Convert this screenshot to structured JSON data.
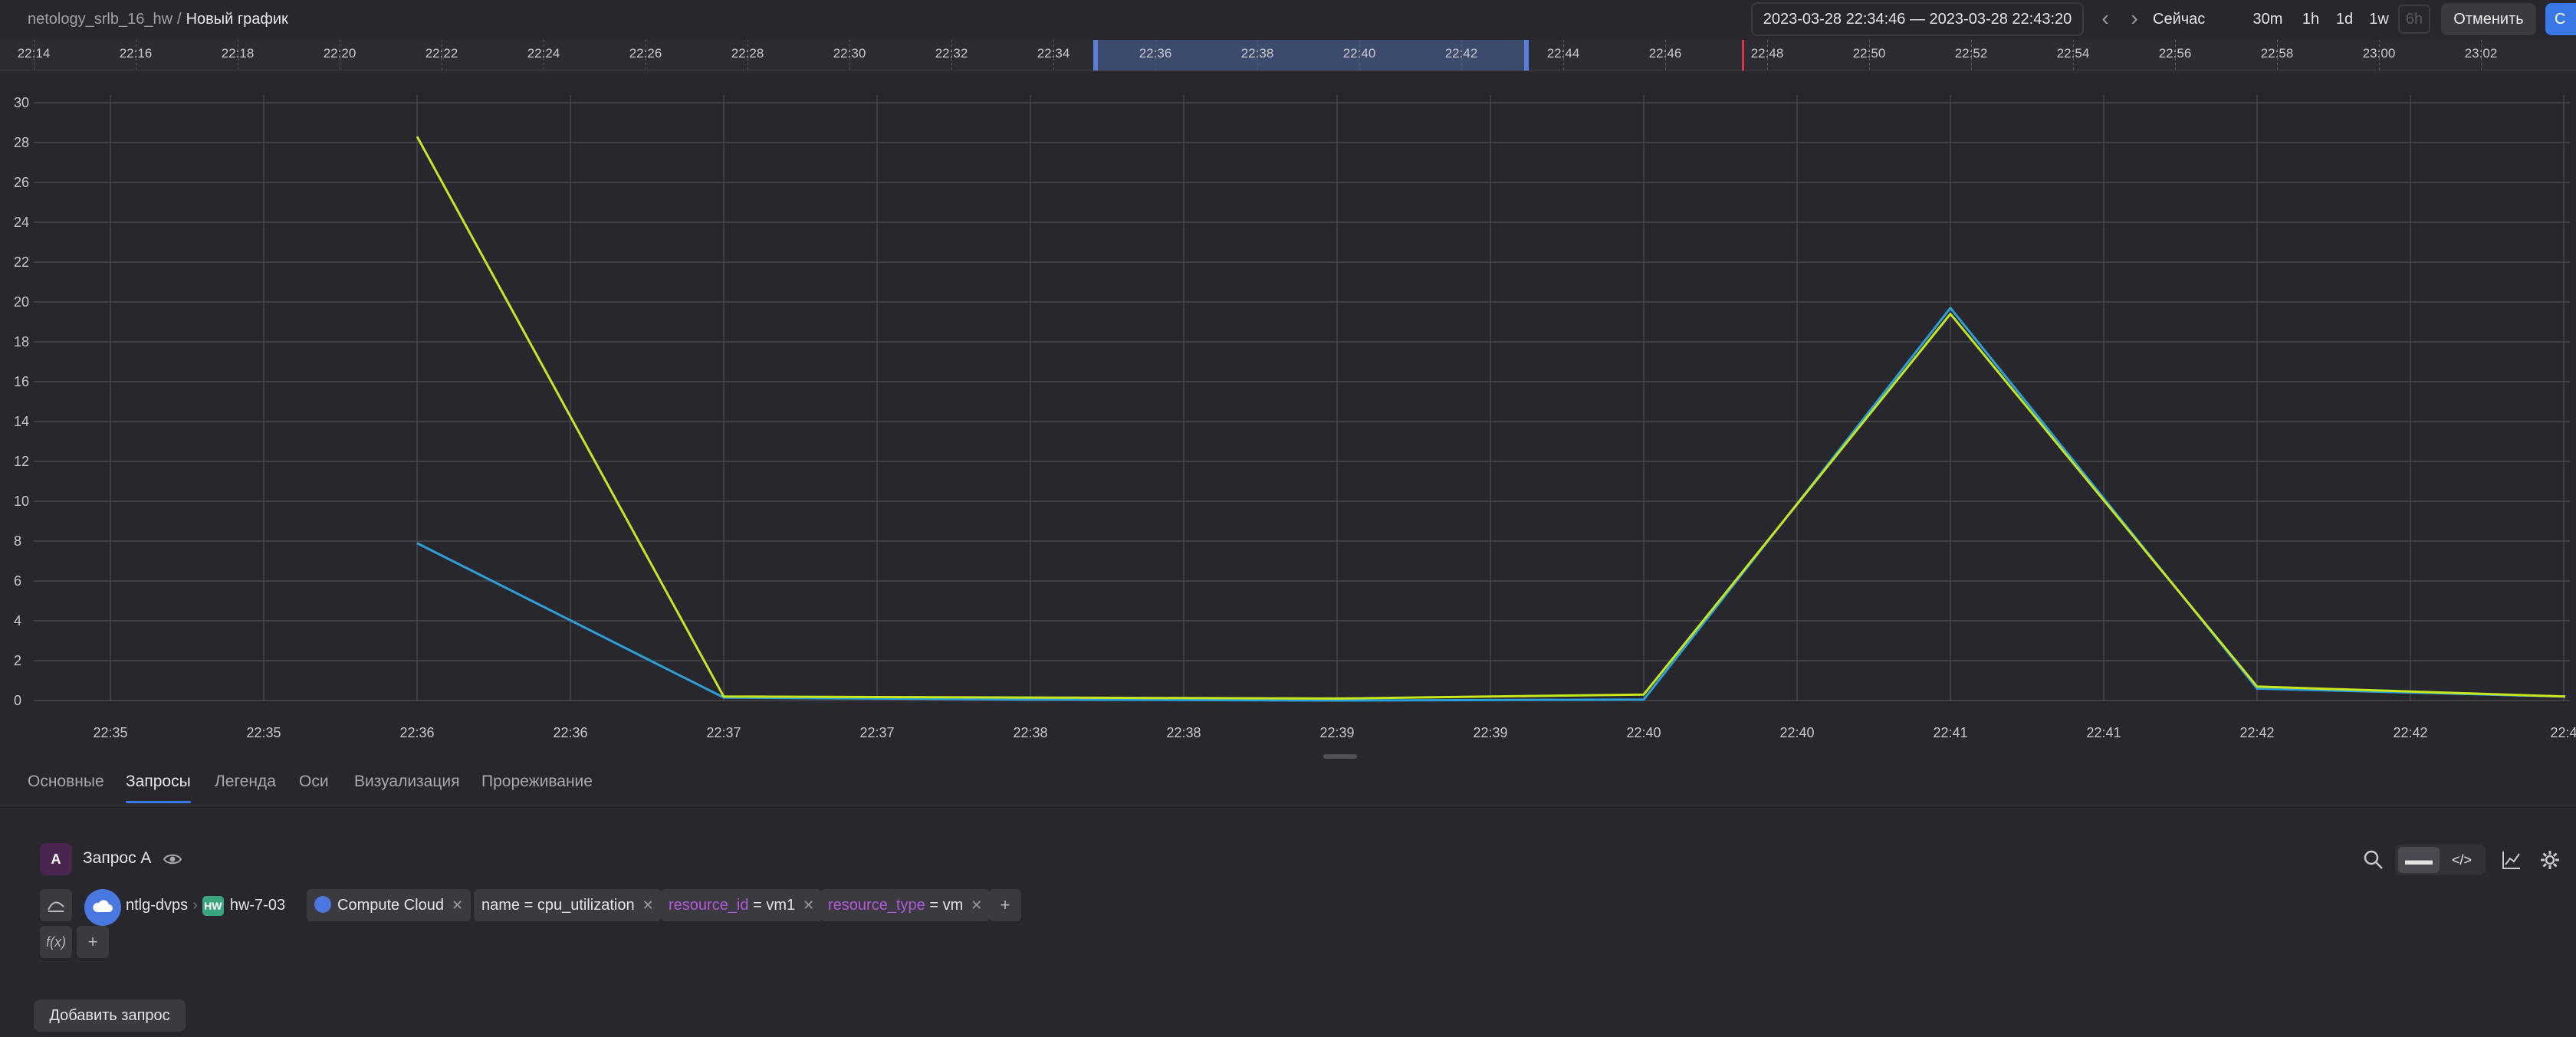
{
  "breadcrumb": {
    "project": "netology_srlb_16_hw",
    "separator": "/",
    "current": "Новый график"
  },
  "header": {
    "date_range": "2023-03-28 22:34:46 — 2023-03-28 22:43:20",
    "prev_icon": "chevron-left-icon",
    "next_icon": "chevron-right-icon",
    "now_label": "Сейчас",
    "ranges": [
      "30m",
      "1h",
      "1d",
      "1w",
      "6h"
    ],
    "cancel_label": "Отменить",
    "primary_label": "С"
  },
  "timeline": {
    "ticks": [
      "22:14",
      "22:16",
      "22:18",
      "22:20",
      "22:22",
      "22:24",
      "22:26",
      "22:28",
      "22:30",
      "22:32",
      "22:34",
      "22:36",
      "22:38",
      "22:40",
      "22:42",
      "22:44",
      "22:46",
      "22:48",
      "22:50",
      "22:52",
      "22:54",
      "22:56",
      "22:58",
      "23:00",
      "23:02"
    ],
    "selection": [
      "22:34:46",
      "22:43:20"
    ],
    "now_marker": "22:47:40"
  },
  "chart_data": {
    "type": "line",
    "title": "",
    "xlabel": "",
    "ylabel": "",
    "ylim": [
      0,
      30
    ],
    "yticks": [
      0,
      2,
      4,
      6,
      8,
      10,
      12,
      14,
      16,
      18,
      20,
      22,
      24,
      26,
      28,
      30
    ],
    "xtick_labels": [
      "22:35",
      "22:35",
      "22:36",
      "22:36",
      "22:37",
      "22:37",
      "22:38",
      "22:38",
      "22:39",
      "22:39",
      "22:40",
      "22:40",
      "22:41",
      "22:41",
      "22:42",
      "22:42",
      "22:4"
    ],
    "x": [
      "22:36",
      "22:37",
      "22:38",
      "22:39",
      "22:40",
      "22:41",
      "22:42",
      "22:43"
    ],
    "grid": true,
    "series": [
      {
        "color": "#2a9fd8",
        "values": [
          7.9,
          0.15,
          0.05,
          0.0,
          0.05,
          19.7,
          0.6,
          0.2
        ]
      },
      {
        "color": "#c8e61e",
        "values": [
          28.3,
          0.2,
          0.15,
          0.1,
          0.3,
          19.4,
          0.7,
          0.2
        ]
      }
    ]
  },
  "tabs": [
    "Основные",
    "Запросы",
    "Легенда",
    "Оси",
    "Визуализация",
    "Прореживание"
  ],
  "active_tab": 1,
  "query": {
    "letter": "A",
    "name": "Запрос A",
    "eye_icon": "eye-icon",
    "cloud": "ntlg-dvps",
    "folder_badge": "HW",
    "folder": "hw-7-03",
    "service": "Compute Cloud",
    "filters": [
      {
        "key": "name",
        "op": "=",
        "value": "cpu_utilization",
        "highlight": false
      },
      {
        "key": "resource_id",
        "op": "=",
        "value": "vm1",
        "highlight": true
      },
      {
        "key": "resource_type",
        "op": "=",
        "value": "vm",
        "highlight": true
      }
    ],
    "function_label": "f(x)"
  },
  "add_query_label": "Добавить запрос"
}
